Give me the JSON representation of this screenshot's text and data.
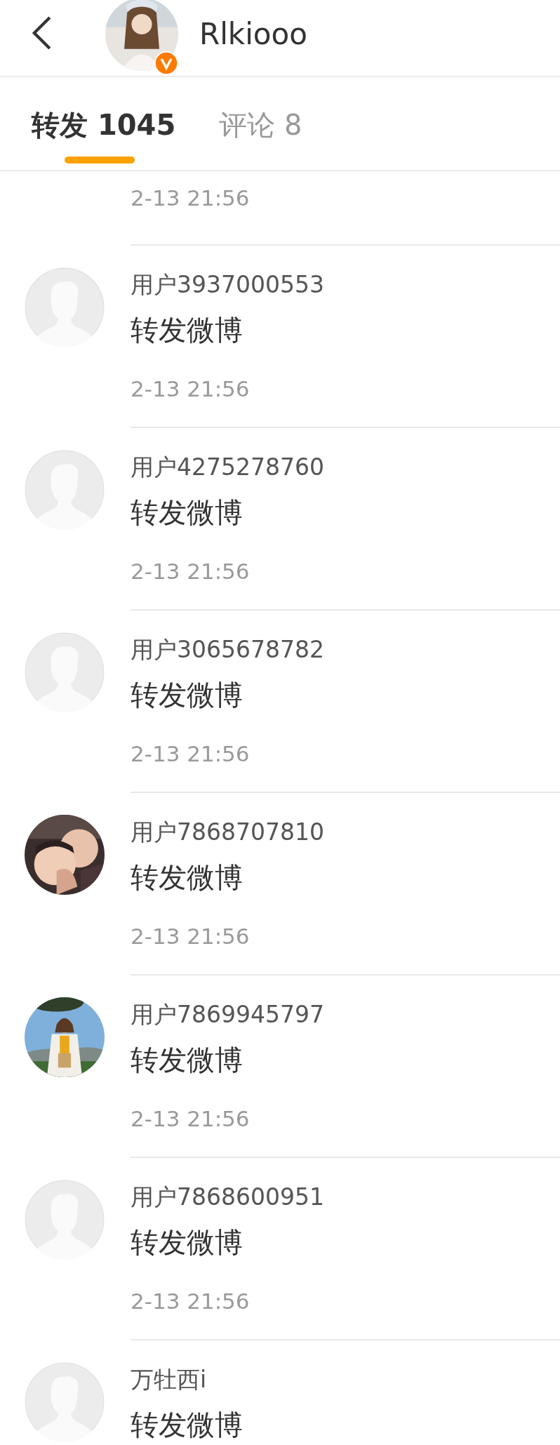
{
  "header": {
    "title": "Rlkiooo",
    "avatar": {
      "kind": "picture",
      "verified": true
    }
  },
  "tabs": [
    {
      "label": "转发 1045",
      "selected": true
    },
    {
      "label": "评论 8",
      "selected": false
    }
  ],
  "items": [
    {
      "time": "2-13 21:56"
    },
    {
      "avatar": {
        "kind": "default"
      },
      "name": "用户3937000553",
      "text": "转发微博",
      "time": "2-13 21:56"
    },
    {
      "avatar": {
        "kind": "default"
      },
      "name": "用户4275278760",
      "text": "转发微博",
      "time": "2-13 21:56"
    },
    {
      "avatar": {
        "kind": "default"
      },
      "name": "用户3065678782",
      "text": "转发微博",
      "time": "2-13 21:56"
    },
    {
      "avatar": {
        "kind": "picture"
      },
      "name": "用户7868707810",
      "text": "转发微博",
      "time": "2-13 21:56"
    },
    {
      "avatar": {
        "kind": "picture"
      },
      "name": "用户7869945797",
      "text": "转发微博",
      "time": "2-13 21:56"
    },
    {
      "avatar": {
        "kind": "default"
      },
      "name": "用户7868600951",
      "text": "转发微博",
      "time": "2-13 21:56"
    },
    {
      "avatar": {
        "kind": "default"
      },
      "name": "万牡西i",
      "text": "转发微博"
    }
  ]
}
